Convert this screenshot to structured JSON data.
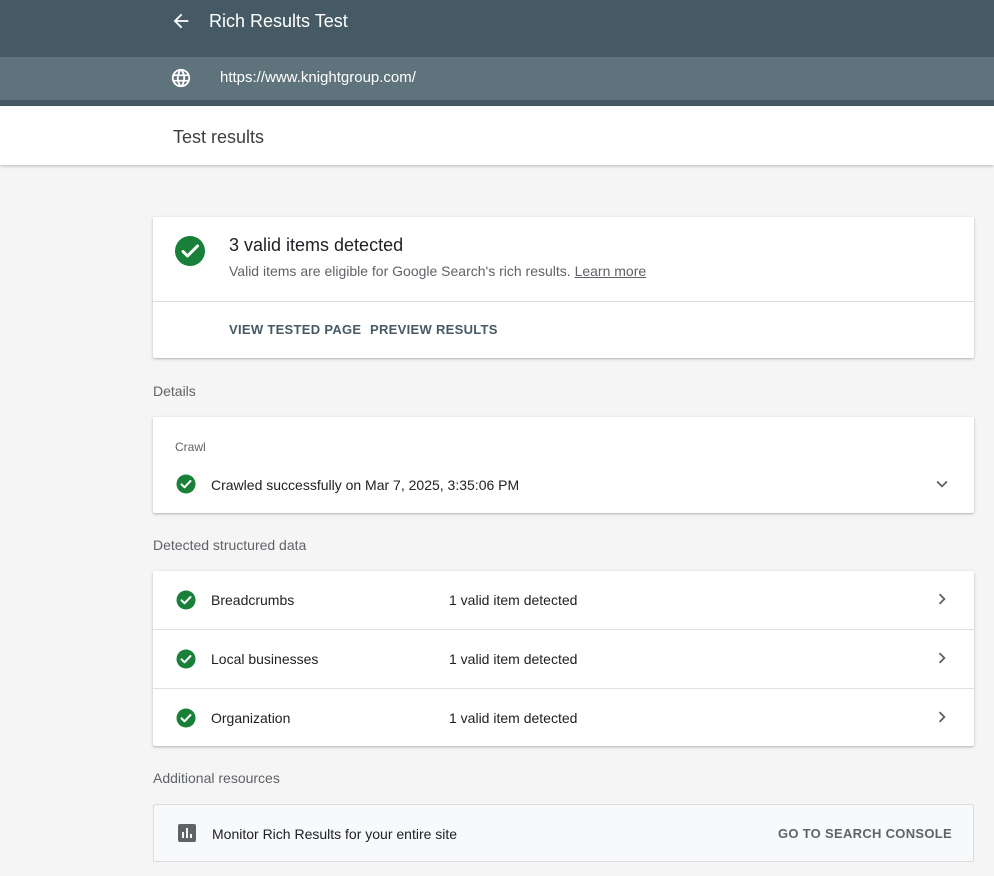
{
  "header": {
    "title": "Rich Results Test",
    "back_icon": "arrow-left-icon"
  },
  "url_bar": {
    "icon": "globe-icon",
    "url": "https://www.knightgroup.com/"
  },
  "results_header": {
    "title": "Test results"
  },
  "summary": {
    "title": "3 valid items detected",
    "description": "Valid items are eligible for Google Search's rich results.",
    "learn_more": "Learn more",
    "actions": {
      "view_tested_page": "VIEW TESTED PAGE",
      "preview_results": "PREVIEW RESULTS"
    }
  },
  "details": {
    "section_label": "Details",
    "crawl_label": "Crawl",
    "crawl_status": "Crawled successfully on Mar 7, 2025, 3:35:06 PM"
  },
  "structured_data": {
    "section_label": "Detected structured data",
    "items": [
      {
        "name": "Breadcrumbs",
        "status": "1 valid item detected"
      },
      {
        "name": "Local businesses",
        "status": "1 valid item detected"
      },
      {
        "name": "Organization",
        "status": "1 valid item detected"
      }
    ]
  },
  "additional_resources": {
    "section_label": "Additional resources",
    "monitor_text": "Monitor Rich Results for your entire site",
    "console_button": "GO TO SEARCH CONSOLE"
  },
  "colors": {
    "topbar": "#455a64",
    "urlbar": "#5f737d",
    "success": "#188038",
    "background": "#f5f5f5"
  }
}
